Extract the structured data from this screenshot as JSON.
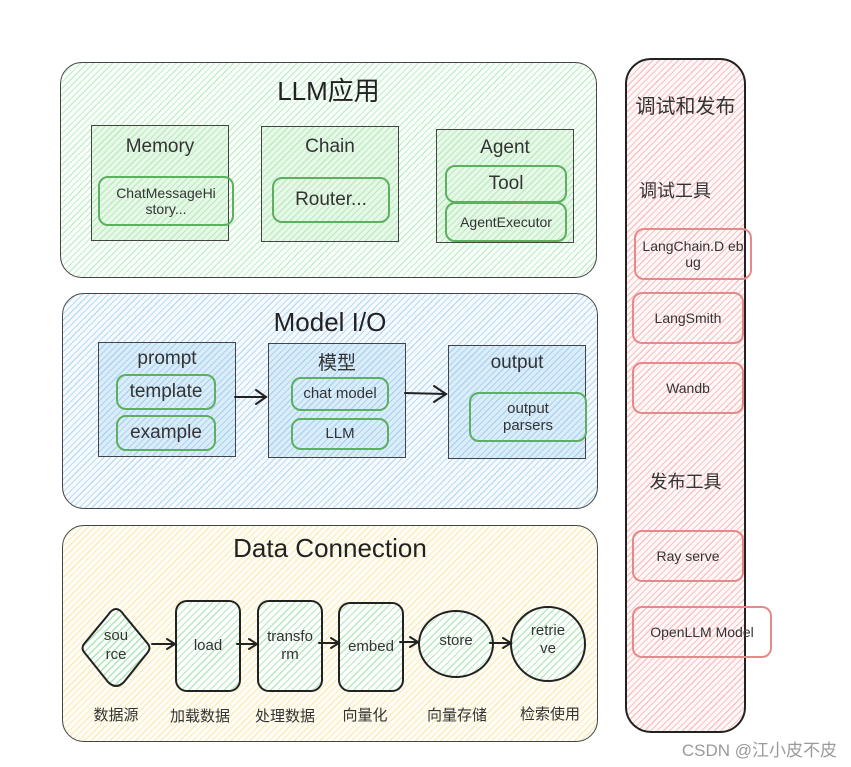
{
  "llm_app": {
    "title": "LLM应用",
    "memory": {
      "label": "Memory",
      "items": [
        "ChatMessageHi story..."
      ]
    },
    "chain": {
      "label": "Chain",
      "items": [
        "Router..."
      ]
    },
    "agent": {
      "label": "Agent",
      "items": [
        "Tool",
        "AgentExecutor"
      ]
    }
  },
  "model_io": {
    "title": "Model I/O",
    "prompt": {
      "label": "prompt",
      "items": [
        "template",
        "example"
      ]
    },
    "model": {
      "label": "模型",
      "items": [
        "chat model",
        "LLM"
      ]
    },
    "output": {
      "label": "output",
      "items": [
        "output parsers"
      ]
    }
  },
  "data_connection": {
    "title": "Data Connection",
    "steps": [
      {
        "node": "sou rce",
        "caption": "数据源",
        "shape": "diamond"
      },
      {
        "node": "load",
        "caption": "加载数据",
        "shape": "rounded-rect"
      },
      {
        "node": "transfo rm",
        "caption": "处理数据",
        "shape": "rounded-rect"
      },
      {
        "node": "embed",
        "caption": "向量化",
        "shape": "rounded-rect"
      },
      {
        "node": "store",
        "caption": "向量存储",
        "shape": "ellipse"
      },
      {
        "node": "retrie ve",
        "caption": "检索使用",
        "shape": "circle"
      }
    ]
  },
  "debug_deploy": {
    "title": "调试和发布",
    "debug_tools_label": "调试工具",
    "debug_tools": [
      "LangChain.D ebug",
      "LangSmith",
      "Wandb"
    ],
    "deploy_tools_label": "发布工具",
    "deploy_tools": [
      "Ray serve",
      "OpenLLM Model"
    ]
  },
  "colors": {
    "llm_app_fill": "#e8f8e8",
    "model_io_fill": "#dcedfa",
    "data_connection_fill": "#fff8dc",
    "debug_fill": "#fde4e4",
    "green_stroke": "#5cb05f",
    "red_stroke": "#e58a8a",
    "outline": "#222222"
  },
  "watermark": "CSDN @江小皮不皮"
}
